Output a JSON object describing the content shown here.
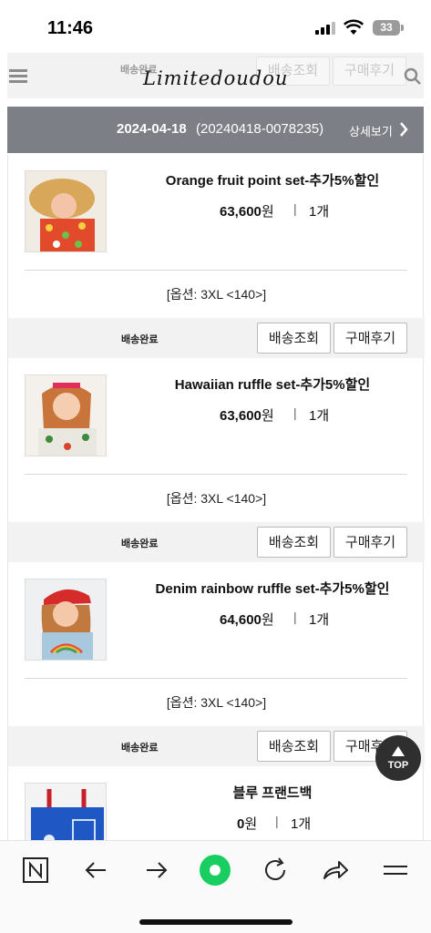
{
  "status_bar": {
    "time": "11:46",
    "battery": "33"
  },
  "header": {
    "logo": "Limitedoudou",
    "hidden_row": {
      "status": "배송완료",
      "track_label": "배송조회",
      "review_label": "구매후기"
    }
  },
  "order": {
    "date": "2024-04-18",
    "order_number": "(20240418-0078235)",
    "detail_label": "상세보기"
  },
  "items": [
    {
      "name": "Orange fruit point set-추가5%할인",
      "price": "63,600",
      "currency": "원",
      "qty": "1개",
      "option": "[옵션: 3XL <140>]",
      "status": "배송완료",
      "track_label": "배송조회",
      "review_label": "구매후기"
    },
    {
      "name": "Hawaiian ruffle set-추가5%할인",
      "price": "63,600",
      "currency": "원",
      "qty": "1개",
      "option": "[옵션: 3XL <140>]",
      "status": "배송완료",
      "track_label": "배송조회",
      "review_label": "구매후기"
    },
    {
      "name": "Denim rainbow ruffle set-추가5%할인",
      "price": "64,600",
      "currency": "원",
      "qty": "1개",
      "option": "[옵션: 3XL <140>]",
      "status": "배송완료",
      "track_label": "배송조회",
      "review_label": "구매후기"
    },
    {
      "name": "블루 프랜드백",
      "price": "0",
      "currency": "원",
      "qty": "1개"
    }
  ],
  "top_button": {
    "label": "TOP"
  },
  "browser_bar": {
    "icons": [
      "naver-n-icon",
      "back-arrow-icon",
      "forward-arrow-icon",
      "green-dot-home-icon",
      "refresh-icon",
      "share-icon",
      "menu-icon"
    ]
  }
}
